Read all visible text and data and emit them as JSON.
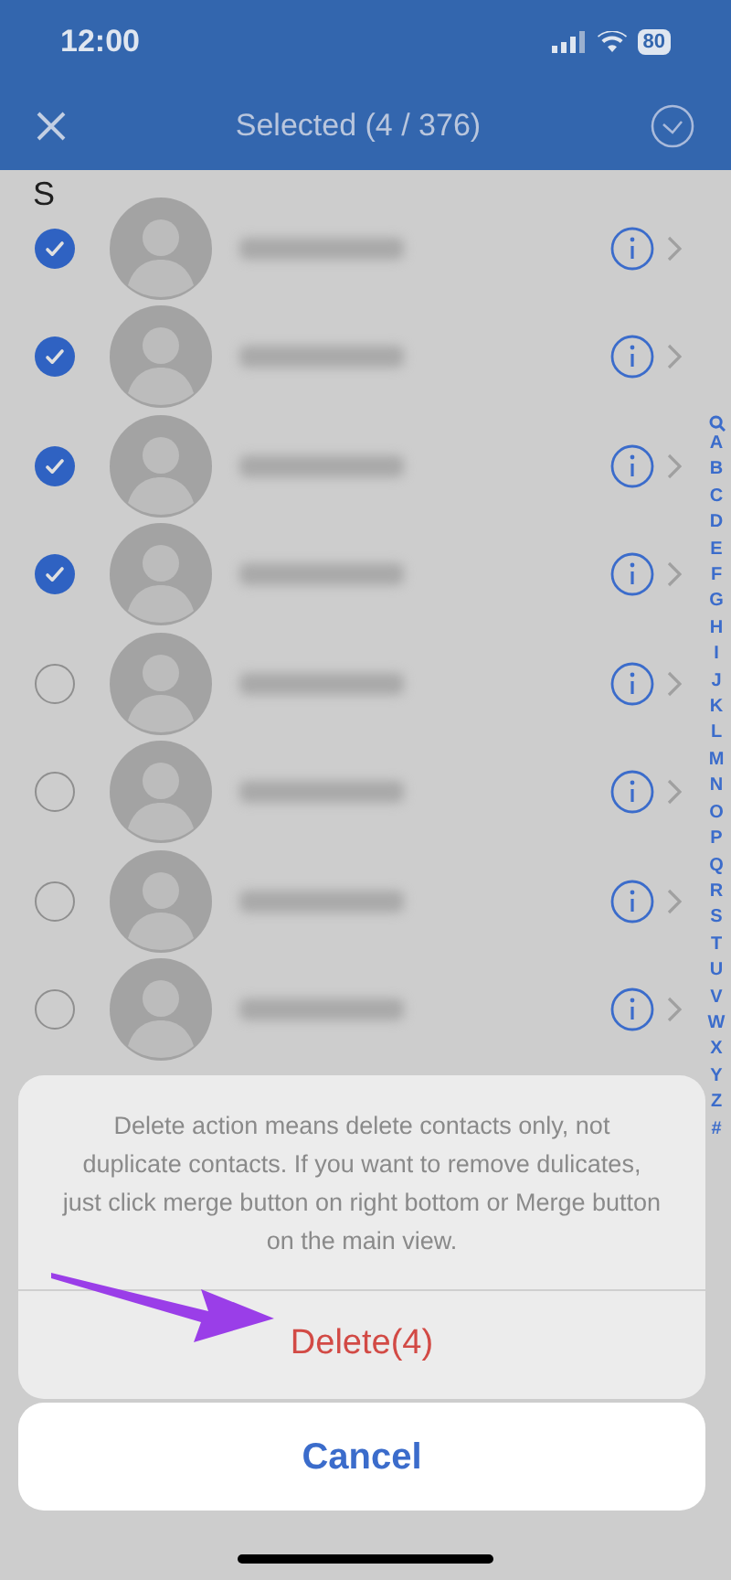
{
  "status_bar": {
    "time": "12:00",
    "battery": "80"
  },
  "nav": {
    "title": "Selected (4 / 376)"
  },
  "section": "S",
  "contacts": [
    {
      "selected": true
    },
    {
      "selected": true
    },
    {
      "selected": true
    },
    {
      "selected": true
    },
    {
      "selected": false
    },
    {
      "selected": false
    },
    {
      "selected": false
    },
    {
      "selected": false
    }
  ],
  "index": [
    "A",
    "B",
    "C",
    "D",
    "E",
    "F",
    "G",
    "H",
    "I",
    "J",
    "K",
    "L",
    "M",
    "N",
    "O",
    "P",
    "Q",
    "R",
    "S",
    "T",
    "U",
    "V",
    "W",
    "X",
    "Y",
    "Z",
    "#"
  ],
  "action_sheet": {
    "message": "Delete action means delete contacts only, not duplicate contacts. If you want to remove dulicates, just click merge button on right bottom or Merge button on the main view.",
    "destructive": "Delete(4)",
    "cancel": "Cancel"
  }
}
